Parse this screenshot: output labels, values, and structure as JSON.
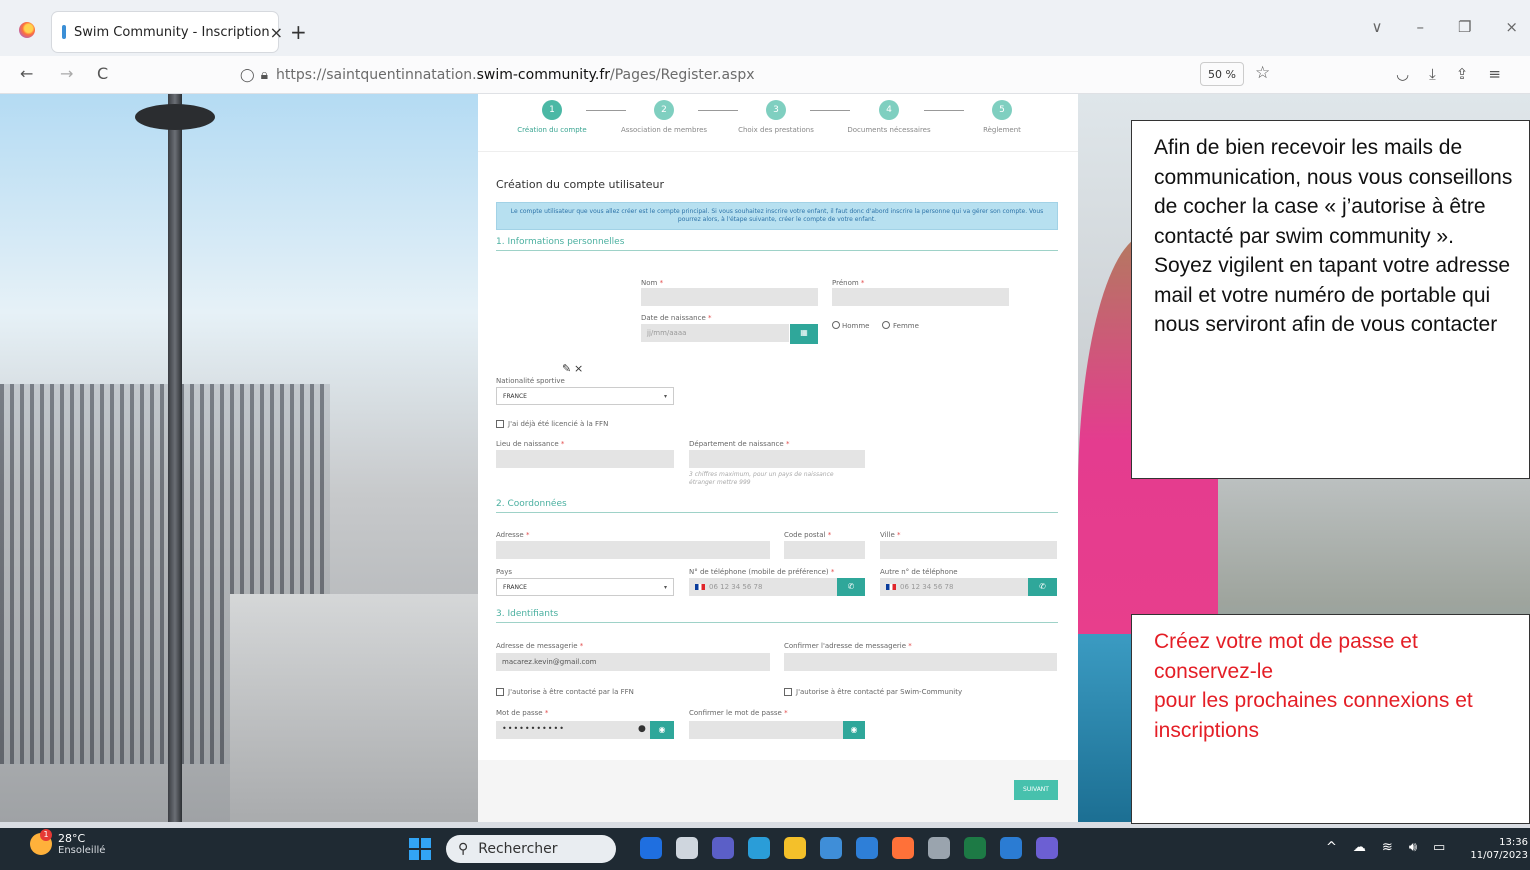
{
  "browser": {
    "tab_title": "Swim Community - Inscription",
    "tab_close": "×",
    "new_tab": "+",
    "url_prefix": "https://saintquentinnatation.",
    "url_domain": "swim-community.fr",
    "url_path": "/Pages/Register.aspx",
    "zoom": "50 %",
    "nav_back": "←",
    "nav_forward": "→",
    "nav_reload": "C",
    "win_controls": [
      "∨",
      "–",
      "❐",
      "×"
    ],
    "toolbar_icons": [
      "pocket-icon",
      "download-icon",
      "share-icon",
      "menu-icon"
    ]
  },
  "stepper": {
    "steps": [
      {
        "num": "1",
        "label": "Création du compte"
      },
      {
        "num": "2",
        "label": "Association de membres"
      },
      {
        "num": "3",
        "label": "Choix des prestations"
      },
      {
        "num": "4",
        "label": "Documents nécessaires"
      },
      {
        "num": "5",
        "label": "Règlement"
      }
    ]
  },
  "form": {
    "title": "Création du compte utilisateur",
    "info": "Le compte utilisateur que vous allez créer est le compte principal. Si vous souhaitez inscrire votre enfant, il faut donc d'abord inscrire la personne qui va gérer son compte. Vous pourrez alors, à l'étape suivante, créer le compte de votre enfant.",
    "section1": "1. Informations personnelles",
    "nom_label": "Nom",
    "prenom_label": "Prénom",
    "dob_label": "Date de naissance",
    "dob_placeholder": "jj/mm/aaaa",
    "homme": "Homme",
    "femme": "Femme",
    "nationalite_label": "Nationalité sportive",
    "nationalite_value": "FRANCE",
    "ffn_checkbox": "J'ai déjà été licencié à la FFN",
    "lieu_label": "Lieu de naissance",
    "dept_label": "Département de naissance",
    "dept_hint1": "3 chiffres maximum, pour un pays de naissance",
    "dept_hint2": "étranger mettre 999",
    "section2": "2. Coordonnées",
    "adresse_label": "Adresse",
    "cp_label": "Code postal",
    "ville_label": "Ville",
    "pays_label": "Pays",
    "pays_value": "FRANCE",
    "tel_label": "N° de téléphone (mobile de préférence)",
    "tel_placeholder": "06 12 34 56 78",
    "tel2_label": "Autre n° de téléphone",
    "tel2_placeholder": "06 12 34 56 78",
    "section3": "3. Identifiants",
    "email_label": "Adresse de messagerie",
    "email_value": "macarez.kevin@gmail.com",
    "email_confirm_label": "Confirmer l'adresse de messagerie",
    "ffn_contact": "J'autorise à être contacté par la FFN",
    "swim_contact": "J'autorise à être contacté par Swim-Community",
    "pw_label": "Mot de passe",
    "pw_value": "•••••••••••",
    "pw_confirm_label": "Confirmer le mot de passe",
    "next_button": "SUIVANT"
  },
  "notes": {
    "note1": [
      "Afin de bien recevoir les mails de communication, nous vous conseillons de cocher la case « j’autorise à être contacté par swim community ».",
      "Soyez vigilent en tapant votre adresse mail et votre numéro de portable qui nous serviront afin de vous contacter"
    ],
    "note2": [
      "Créez votre mot de passe et conservez-le",
      "pour les prochaines connexions et inscriptions"
    ]
  },
  "taskbar": {
    "temp": "28°C",
    "weather": "Ensoleillé",
    "badge": "1",
    "search": "Rechercher",
    "time": "13:36",
    "date": "11/07/2023",
    "app_colors": [
      "#1f6fe0",
      "#cfd6de",
      "#5b5fc7",
      "#2a9dd8",
      "#f4c02a",
      "#3f8ed8",
      "#2e7fd8",
      "#ff7139",
      "#9aa4ae",
      "#1d7a45",
      "#2b7cd3",
      "#6c5fd3"
    ]
  }
}
